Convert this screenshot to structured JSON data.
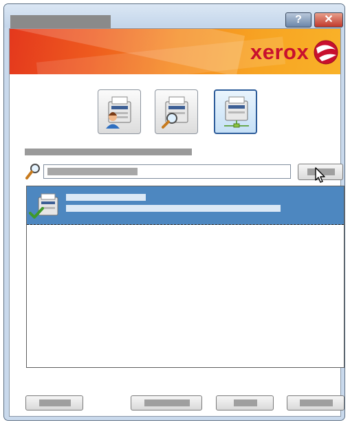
{
  "window": {
    "title": "",
    "help_label": "?",
    "close_label": "✕"
  },
  "banner": {
    "logo_text": "xerox",
    "brand_color": "#c8102e"
  },
  "modes": [
    {
      "id": "printer-user",
      "icon": "printer-user-icon",
      "selected": false
    },
    {
      "id": "printer-search",
      "icon": "printer-search-icon",
      "selected": false
    },
    {
      "id": "printer-network",
      "icon": "printer-network-icon",
      "selected": true
    }
  ],
  "search": {
    "section_label": "",
    "value": "",
    "button_label": ""
  },
  "printers": [
    {
      "name": "",
      "detail": "",
      "status_icon": "check-icon",
      "selected": true
    }
  ],
  "footer": {
    "buttons": [
      "",
      "",
      "",
      ""
    ]
  },
  "colors": {
    "selection": "#4d87c0",
    "selected_mode_border": "#2d5c9a"
  }
}
